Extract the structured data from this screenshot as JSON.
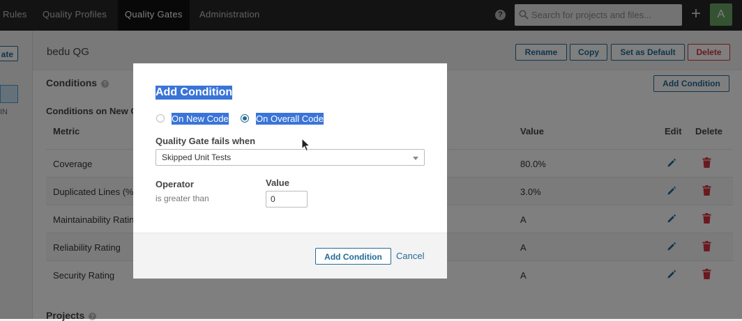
{
  "nav": {
    "items": [
      "Rules",
      "Quality Profiles",
      "Quality Gates",
      "Administration"
    ],
    "active": "Quality Gates",
    "help_symbol": "?",
    "search_placeholder": "Search for projects and files...",
    "plus_symbol": "+",
    "avatar_letter": "A"
  },
  "left": {
    "button_fragment": "ate",
    "tag_fragment": "IN"
  },
  "gate": {
    "name": "bedu QG",
    "actions": [
      "Rename",
      "Copy",
      "Set as Default",
      "Delete"
    ]
  },
  "conditions": {
    "title": "Conditions",
    "help_symbol": "?",
    "add_button": "Add Condition",
    "subtitle": "Conditions on New C",
    "columns": {
      "metric": "Metric",
      "value": "Value",
      "edit": "Edit",
      "delete": "Delete"
    },
    "rows": [
      {
        "metric": "Coverage",
        "value": "80.0%"
      },
      {
        "metric": "Duplicated Lines (%",
        "value": "3.0%"
      },
      {
        "metric": "Maintainability Ratin",
        "value": "A"
      },
      {
        "metric": "Reliability Rating",
        "value": "A"
      },
      {
        "metric": "Security Rating",
        "value": "A"
      }
    ]
  },
  "projects": {
    "title": "Projects",
    "help_symbol": "?"
  },
  "modal": {
    "title": "Add Condition",
    "radio_new": "On New Code",
    "radio_overall": "On Overall Code",
    "selected_radio": "overall",
    "fails_label": "Quality Gate fails when",
    "metric_selected": "Skipped Unit Tests",
    "operator_label": "Operator",
    "operator_value": "is greater than",
    "value_label": "Value",
    "value_input": "0",
    "submit": "Add Condition",
    "cancel": "Cancel"
  },
  "colors": {
    "accent": "#236a97",
    "danger": "#d4333f",
    "selection": "#3a74d8",
    "nav_bg": "#262626",
    "avatar": "#6ba667"
  }
}
